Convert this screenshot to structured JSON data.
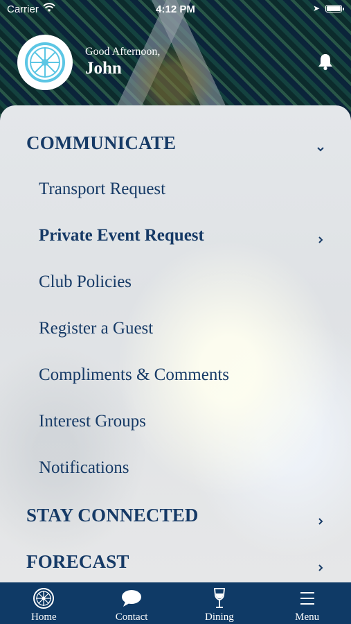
{
  "status_bar": {
    "carrier": "Carrier",
    "time": "4:12 PM"
  },
  "header": {
    "greeting": "Good Afternoon,",
    "user_name": "John"
  },
  "menu": {
    "sections": [
      {
        "label": "COMMUNICATE",
        "expanded": true,
        "items": [
          {
            "label": "Transport Request",
            "bold": false,
            "has_chevron": false
          },
          {
            "label": "Private Event Request",
            "bold": true,
            "has_chevron": true
          },
          {
            "label": "Club Policies",
            "bold": false,
            "has_chevron": false
          },
          {
            "label": "Register a Guest",
            "bold": false,
            "has_chevron": false
          },
          {
            "label": "Compliments & Comments",
            "bold": false,
            "has_chevron": false
          },
          {
            "label": "Interest Groups",
            "bold": false,
            "has_chevron": false
          },
          {
            "label": "Notifications",
            "bold": false,
            "has_chevron": false
          }
        ]
      },
      {
        "label": "STAY CONNECTED",
        "expanded": false
      },
      {
        "label": "FORECAST",
        "expanded": false
      }
    ]
  },
  "tab_bar": {
    "tabs": [
      {
        "label": "Home",
        "icon": "wheel-icon"
      },
      {
        "label": "Contact",
        "icon": "chat-bubble-icon"
      },
      {
        "label": "Dining",
        "icon": "wine-glass-icon"
      },
      {
        "label": "Menu",
        "icon": "hamburger-icon"
      }
    ]
  },
  "colors": {
    "primary": "#163a66",
    "tab_bar": "#0f3a66",
    "logo_accent": "#5cc6e4"
  }
}
